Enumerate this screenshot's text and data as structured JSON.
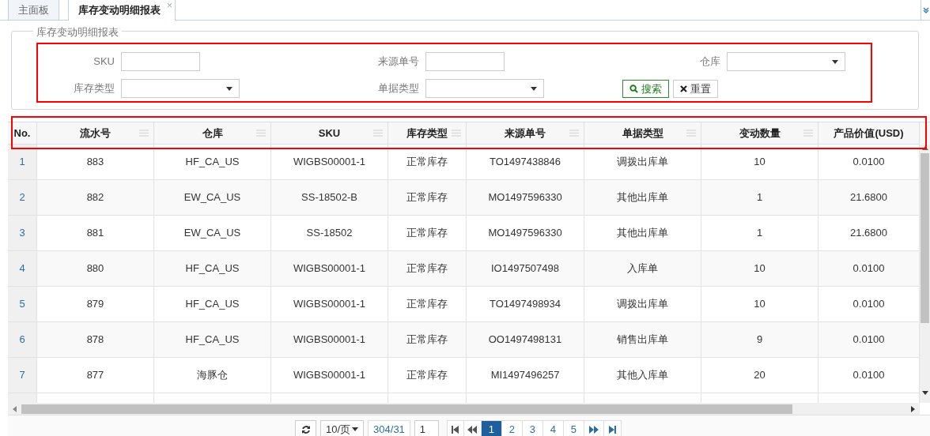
{
  "tabs": [
    {
      "label": "主面板",
      "selected": false
    },
    {
      "label": "库存变动明细报表",
      "selected": true,
      "close_glyph": "×"
    }
  ],
  "filter_panel": {
    "legend": "库存变动明细报表",
    "fields": [
      {
        "label": "SKU",
        "kind": "input"
      },
      {
        "label": "来源单号",
        "kind": "input"
      },
      {
        "label": "仓库",
        "kind": "select"
      },
      {
        "label": "库存类型",
        "kind": "select"
      },
      {
        "label": "单据类型",
        "kind": "select"
      }
    ],
    "buttons": [
      {
        "label": "搜索",
        "kind": "primary"
      },
      {
        "label": "重置",
        "kind": "reset"
      }
    ]
  },
  "table": {
    "columns": [
      {
        "label": "No.",
        "menu": false
      },
      {
        "label": "流水号",
        "menu": true
      },
      {
        "label": "仓库",
        "menu": true
      },
      {
        "label": "SKU",
        "menu": true
      },
      {
        "label": "库存类型",
        "menu": true
      },
      {
        "label": "来源单号",
        "menu": true
      },
      {
        "label": "单据类型",
        "menu": true
      },
      {
        "label": "变动数量",
        "menu": true
      },
      {
        "label": "产品价值(USD)",
        "menu": false
      }
    ],
    "rows": [
      [
        "1",
        "883",
        "HF_CA_US",
        "WIGBS00001-1",
        "正常库存",
        "TO1497438846",
        "调拨出库单",
        "10",
        "0.0100"
      ],
      [
        "2",
        "882",
        "EW_CA_US",
        "SS-18502-B",
        "正常库存",
        "MO1497596330",
        "其他出库单",
        "1",
        "21.6800"
      ],
      [
        "3",
        "881",
        "EW_CA_US",
        "SS-18502",
        "正常库存",
        "MO1497596330",
        "其他出库单",
        "1",
        "21.6800"
      ],
      [
        "4",
        "880",
        "HF_CA_US",
        "WIGBS00001-1",
        "正常库存",
        "IO1497507498",
        "入库单",
        "10",
        "0.0100"
      ],
      [
        "5",
        "879",
        "HF_CA_US",
        "WIGBS00001-1",
        "正常库存",
        "TO1497498934",
        "调拨出库单",
        "10",
        "0.0100"
      ],
      [
        "6",
        "878",
        "HF_CA_US",
        "WIGBS00001-1",
        "正常库存",
        "OO1497498131",
        "销售出库单",
        "9",
        "0.0100"
      ],
      [
        "7",
        "877",
        "海豚仓",
        "WIGBS00001-1",
        "正常库存",
        "MI1497496257",
        "其他入库单",
        "20",
        "0.0100"
      ]
    ]
  },
  "pager": {
    "page_size": "10/页",
    "total": "304/31",
    "page_input": "1",
    "pages": [
      {
        "label": "1",
        "selected": true
      },
      {
        "label": "2",
        "selected": false
      },
      {
        "label": "3",
        "selected": false
      },
      {
        "label": "4",
        "selected": false
      },
      {
        "label": "5",
        "selected": false
      }
    ]
  }
}
